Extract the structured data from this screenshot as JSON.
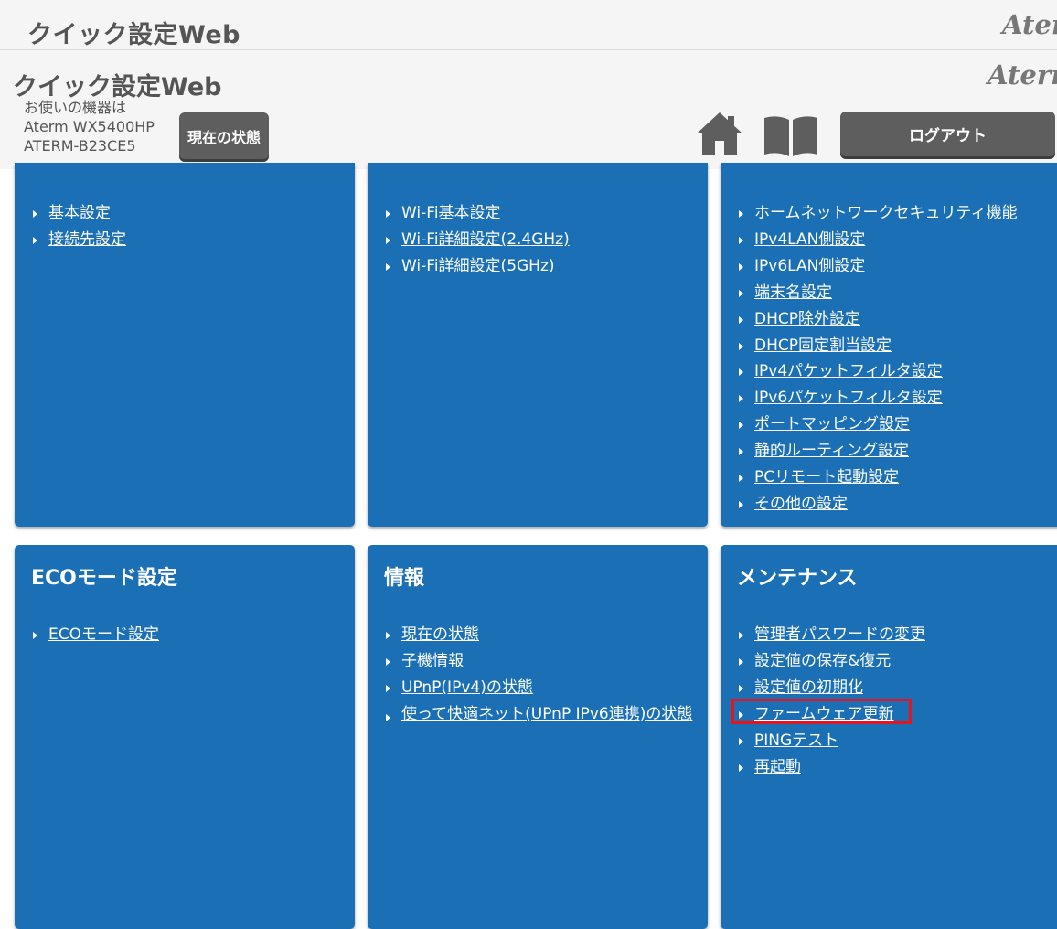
{
  "top_bar": {
    "title": "クイック設定Web",
    "logo": "Aterm"
  },
  "header": {
    "title": "クイック設定Web",
    "logo": "Aterm",
    "device_label": "お使いの機器は",
    "device_model": "Aterm WX5400HP",
    "device_id": "ATERM-B23CE5",
    "status_button": "現在の状態",
    "logout_button": "ログアウト",
    "home_icon": "home-icon",
    "manual_icon": "book-icon"
  },
  "panels": [
    {
      "title": "",
      "links": [
        "基本設定",
        "接続先設定"
      ]
    },
    {
      "title": "",
      "links": [
        "Wi-Fi基本設定",
        "Wi-Fi詳細設定(2.4GHz)",
        "Wi-Fi詳細設定(5GHz)"
      ]
    },
    {
      "title": "",
      "links": [
        "ホームネットワークセキュリティ機能",
        "IPv4LAN側設定",
        "IPv6LAN側設定",
        "端末名設定",
        "DHCP除外設定",
        "DHCP固定割当設定",
        "IPv4パケットフィルタ設定",
        "IPv6パケットフィルタ設定",
        "ポートマッピング設定",
        "静的ルーティング設定",
        "PCリモート起動設定",
        "その他の設定"
      ]
    },
    {
      "title": "ECOモード設定",
      "links": [
        "ECOモード設定"
      ]
    },
    {
      "title": "情報",
      "links": [
        "現在の状態",
        "子機情報",
        "UPnP(IPv4)の状態",
        "使って快適ネット(UPnP IPv6連携)の状態"
      ]
    },
    {
      "title": "メンテナンス",
      "links": [
        "管理者パスワードの変更",
        "設定値の保存&復元",
        "設定値の初期化",
        "ファームウェア更新",
        "PINGテスト",
        "再起動"
      ]
    }
  ],
  "colors": {
    "panel": "#1a6fb5",
    "header_bg": "#f5f5f5",
    "button": "#5e5e5e",
    "highlight": "#e4151f"
  }
}
